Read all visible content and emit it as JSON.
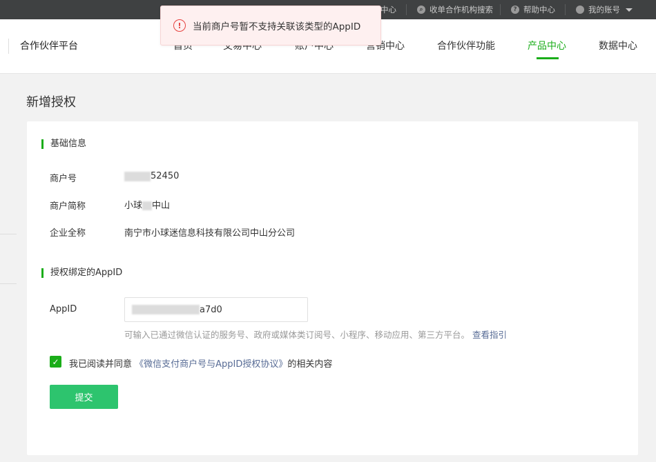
{
  "topbar": {
    "items": [
      {
        "label": "消息中心",
        "icon": "mail-icon"
      },
      {
        "label": "收单合作机构搜索",
        "icon": "search-icon"
      },
      {
        "label": "帮助中心",
        "icon": "help-icon"
      },
      {
        "label": "我的账号",
        "icon": "user-icon"
      }
    ]
  },
  "toast": {
    "icon": "warning-icon",
    "message": "当前商户号暂不支持关联该类型的AppID"
  },
  "header": {
    "brand": "合作伙伴平台",
    "nav": [
      "首页",
      "交易中心",
      "账户中心",
      "营销中心",
      "合作伙伴功能",
      "产品中心",
      "数据中心"
    ],
    "active_nav": "产品中心"
  },
  "page": {
    "title": "新增授权"
  },
  "basic": {
    "section_title": "基础信息",
    "merchant_id_label": "商户号",
    "merchant_id_value": "52450",
    "short_name_label": "商户简称",
    "short_name_prefix": "小球",
    "short_name_suffix": "中山",
    "full_name_label": "企业全称",
    "full_name_value": "南宁市小球迷信息科技有限公司中山分公司"
  },
  "appid_section": {
    "section_title": "授权绑定的AppID",
    "appid_label": "AppID",
    "appid_value": "a7d0",
    "hint_text": "可输入已通过微信认证的服务号、政府或媒体类订阅号、小程序、移动应用、第三方平台。",
    "hint_link": "查看指引"
  },
  "agreement": {
    "checked": true,
    "prefix": "我已阅读并同意",
    "link": "《微信支付商户号与AppID授权协议》",
    "suffix": "的相关内容"
  },
  "submit_label": "提交",
  "colors": {
    "brand_green": "#1aad19",
    "button_green": "#2dc46e",
    "link_blue": "#576b95",
    "error_red": "#e64340"
  }
}
